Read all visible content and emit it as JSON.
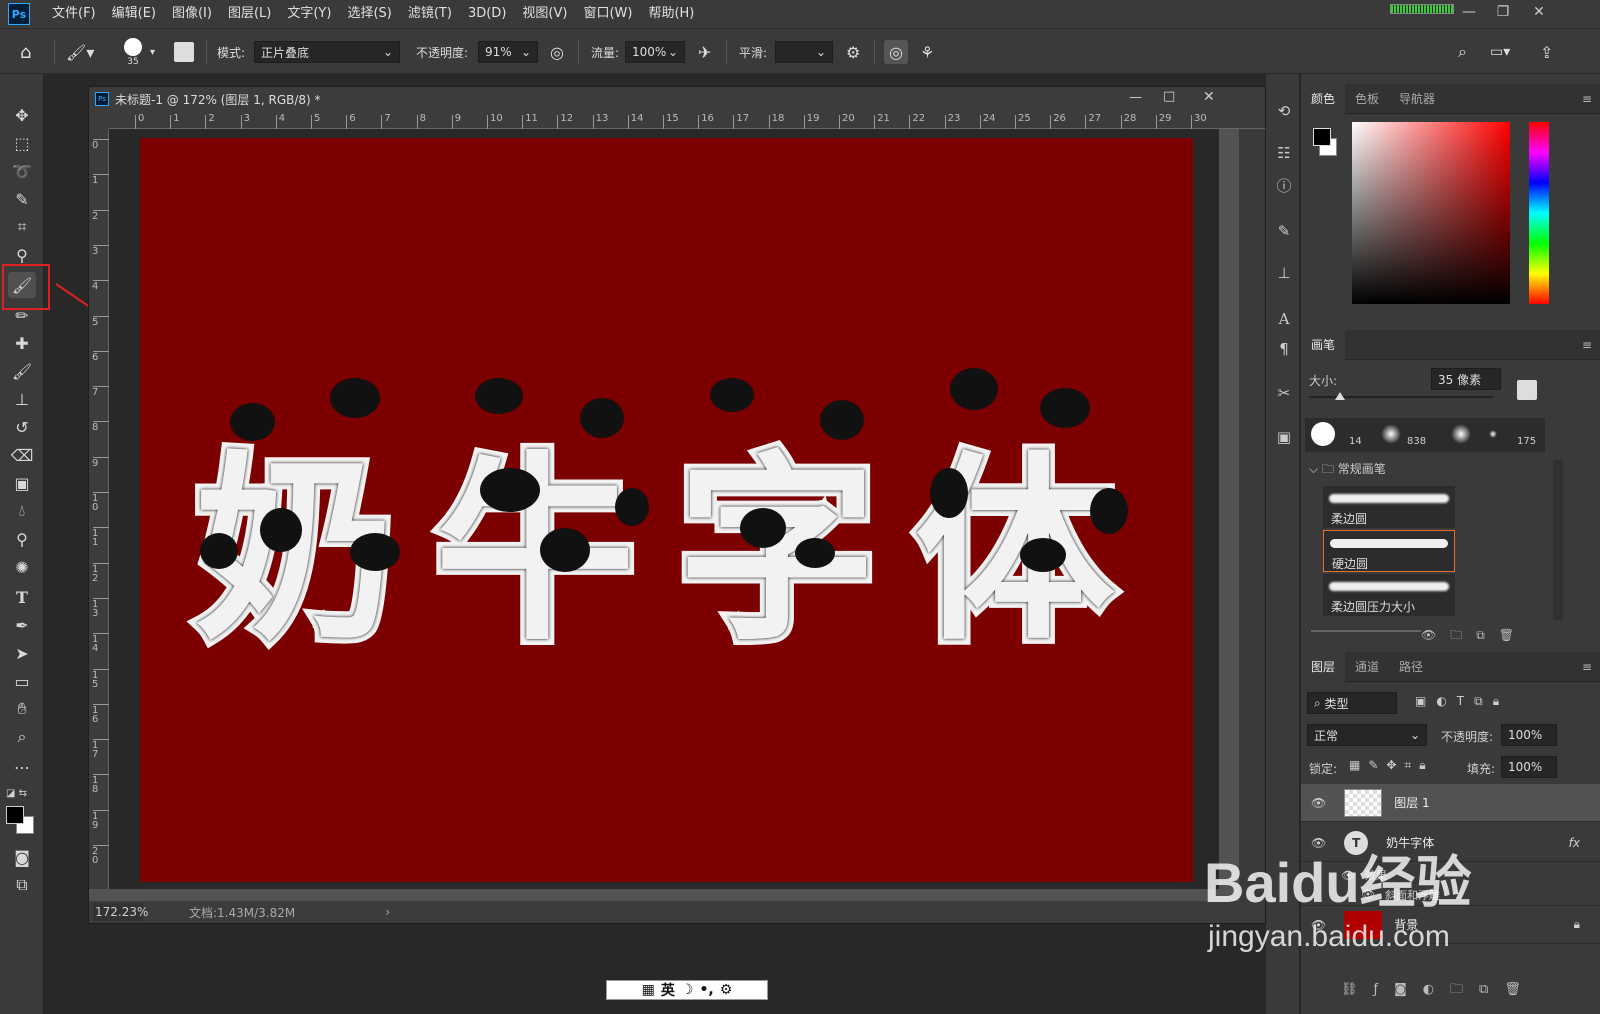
{
  "app": {
    "logo": "Ps"
  },
  "menubar": {
    "items": [
      "文件(F)",
      "编辑(E)",
      "图像(I)",
      "图层(L)",
      "文字(Y)",
      "选择(S)",
      "滤镜(T)",
      "3D(D)",
      "视图(V)",
      "窗口(W)",
      "帮助(H)"
    ]
  },
  "options": {
    "brush_size": "35",
    "mode_label": "模式:",
    "mode_value": "正片叠底",
    "opacity_label": "不透明度:",
    "opacity_value": "91%",
    "flow_label": "流量:",
    "flow_value": "100%",
    "smooth_label": "平滑:",
    "smooth_value": ""
  },
  "document": {
    "title": "未标题-1 @ 172% (图层 1, RGB/8) *",
    "canvas_text": [
      "奶",
      "牛",
      "字",
      "体"
    ],
    "canvas_color": "#7d0000",
    "zoom": "172.23%",
    "doc_info": "文档:1.43M/3.82M",
    "ruler_h": [
      "0",
      "1",
      "2",
      "3",
      "4",
      "5",
      "6",
      "7",
      "8",
      "9",
      "10",
      "11",
      "12",
      "13",
      "14",
      "15",
      "16",
      "17",
      "18",
      "19",
      "20",
      "21",
      "22",
      "23",
      "24",
      "25",
      "26",
      "27",
      "28",
      "29",
      "30"
    ],
    "ruler_v": [
      "0",
      "1",
      "2",
      "3",
      "4",
      "5",
      "6",
      "7",
      "8",
      "9",
      "1\n0",
      "1\n1",
      "1\n2",
      "1\n3",
      "1\n4",
      "1\n5",
      "1\n6",
      "1\n7",
      "1\n8",
      "1\n9",
      "2\n0"
    ]
  },
  "color_panel": {
    "tabs": [
      "颜色",
      "色板",
      "导航器"
    ],
    "foreground": "#000000",
    "background": "#ffffff"
  },
  "brush_panel": {
    "title": "画笔",
    "size_label": "大小:",
    "size_value": "35 像素",
    "preset_sizes": [
      "",
      "14",
      "",
      "838",
      "",
      "",
      "175"
    ],
    "group": "常规画笔",
    "brushes": [
      "柔边圆",
      "硬边圆",
      "柔边圆压力大小"
    ]
  },
  "layers_panel": {
    "tabs": [
      "图层",
      "通道",
      "路径"
    ],
    "filter": "类型",
    "blend_mode": "正常",
    "opacity_label": "不透明度:",
    "opacity_value": "100%",
    "lock_label": "锁定:",
    "fill_label": "填充:",
    "fill_value": "100%",
    "layers": [
      {
        "name": "图层 1",
        "visible": true,
        "selected": true
      },
      {
        "name": "奶牛字体",
        "visible": true,
        "fx": "fx"
      },
      {
        "name": "效果",
        "visible": true
      },
      {
        "name": "斜面和浮雕",
        "visible": true
      },
      {
        "name": "背景",
        "visible": true,
        "locked": true
      }
    ]
  },
  "watermark": {
    "line1": "Baidu经验",
    "line2": "jingyan.baidu.com"
  },
  "ime": {
    "label": "英"
  }
}
